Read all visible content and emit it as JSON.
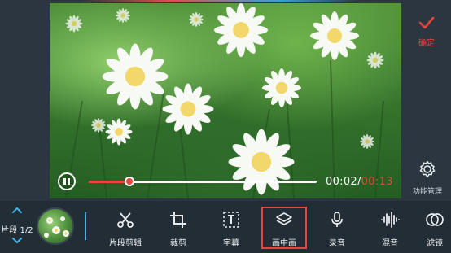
{
  "colors": {
    "accent_red": "#e8453c",
    "background": "#2b3640",
    "toolbar_bg": "#232d35",
    "divider_blue": "#3fb6e6"
  },
  "player": {
    "state": "playing",
    "progress_fraction": 0.18,
    "current_time": "00:02",
    "separator": "/",
    "total_time": "00:13"
  },
  "right_panel": {
    "confirm_label": "确定",
    "confirm_icon": "checkmark-icon",
    "function_manage_label": "功能管理",
    "function_manage_icon": "gear-icon"
  },
  "clip_nav": {
    "label": "片段 1/2"
  },
  "tools": [
    {
      "id": "clip-edit",
      "label": "片段剪辑",
      "icon": "scissors-icon"
    },
    {
      "id": "crop",
      "label": "裁剪",
      "icon": "crop-icon"
    },
    {
      "id": "subtitle",
      "label": "字幕",
      "icon": "text-frame-icon"
    },
    {
      "id": "pip",
      "label": "画中画",
      "icon": "layers-icon",
      "selected": true
    },
    {
      "id": "record",
      "label": "录音",
      "icon": "microphone-icon"
    },
    {
      "id": "mix",
      "label": "混音",
      "icon": "waveform-icon"
    },
    {
      "id": "filter",
      "label": "滤镜",
      "icon": "filter-circles-icon"
    }
  ]
}
